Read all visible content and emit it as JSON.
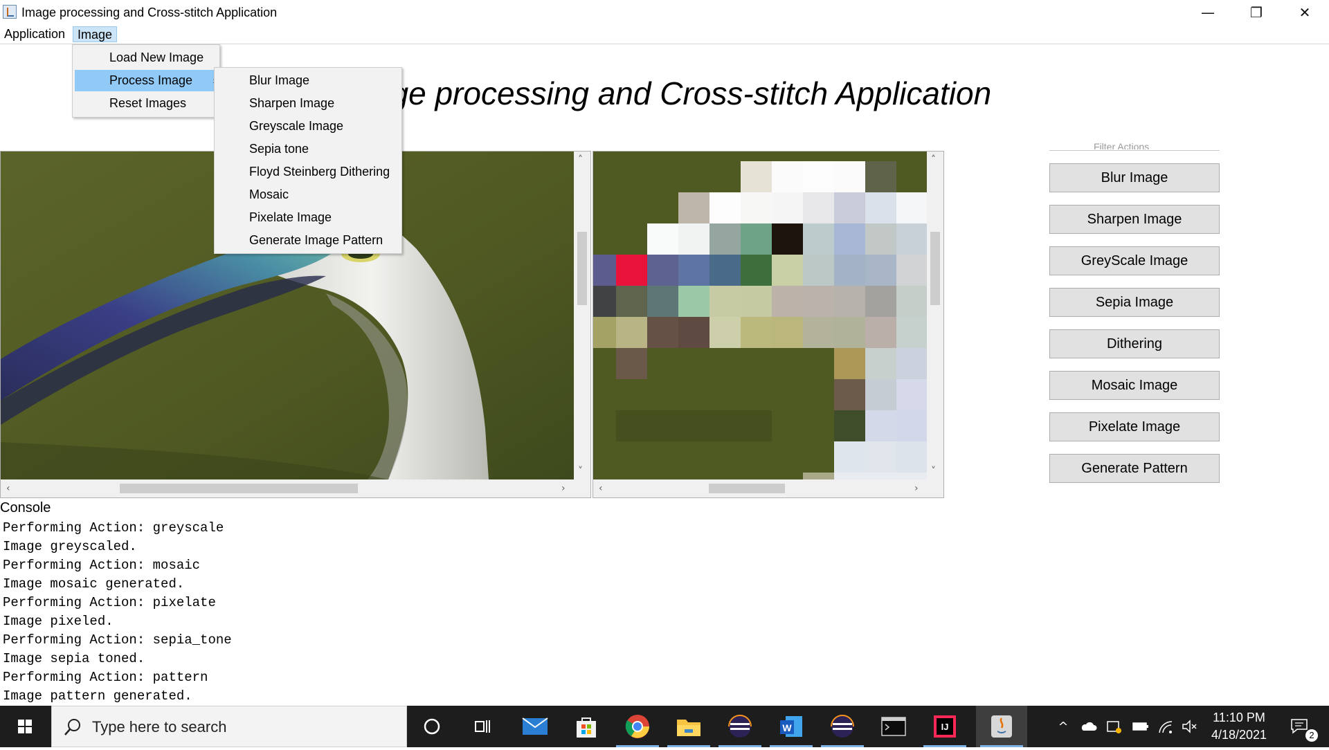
{
  "window": {
    "title": "Image processing and Cross-stitch Application",
    "minimize_glyph": "—",
    "restore_glyph": "❐",
    "close_glyph": "✕"
  },
  "menubar": {
    "items": [
      {
        "label": "Application"
      },
      {
        "label": "Image",
        "open": true
      }
    ]
  },
  "image_menu": {
    "items": [
      {
        "label": "Load New Image"
      },
      {
        "label": "Process Image",
        "has_submenu": true,
        "highlighted": true
      },
      {
        "label": "Reset Images"
      }
    ],
    "submenu_arrow": "›"
  },
  "process_submenu": {
    "items": [
      {
        "label": "Blur Image"
      },
      {
        "label": "Sharpen Image"
      },
      {
        "label": "Greyscale Image"
      },
      {
        "label": "Sepia tone"
      },
      {
        "label": "Floyd Steinberg Dithering"
      },
      {
        "label": "Mosaic"
      },
      {
        "label": "Pixelate Image"
      },
      {
        "label": "Generate Image Pattern"
      }
    ]
  },
  "heading": {
    "text": "Image processing and Cross-stitch Application"
  },
  "scroll_arrows": {
    "up": "˄",
    "down": "˅",
    "left": "‹",
    "right": "›"
  },
  "left_panel": {
    "image": "heron-photo",
    "vertical_scroll_fraction": 0.29,
    "horizontal_scroll_fraction": 0.34
  },
  "right_panel": {
    "image": "pixelated-heron",
    "vertical_scroll_fraction": 0.29,
    "horizontal_scroll_fraction": 0.44
  },
  "actions": {
    "group_label": "Filter Actions",
    "buttons": [
      {
        "label": "Blur Image"
      },
      {
        "label": "Sharpen Image"
      },
      {
        "label": "GreyScale Image"
      },
      {
        "label": "Sepia Image"
      },
      {
        "label": "Dithering"
      },
      {
        "label": "Mosaic Image"
      },
      {
        "label": "Pixelate Image"
      },
      {
        "label": "Generate Pattern"
      }
    ]
  },
  "console": {
    "label": "Console",
    "lines": [
      "Performing Action: greyscale",
      "Image greyscaled.",
      "Performing Action: mosaic",
      "Image mosaic generated.",
      "Performing Action: pixelate",
      "Image pixeled.",
      "Performing Action: sepia_tone",
      "Image sepia toned.",
      "Performing Action: pattern",
      "Image pattern generated."
    ]
  },
  "taskbar": {
    "search_placeholder": "Type here to search",
    "apps": [
      {
        "name": "cortana-icon",
        "active": false
      },
      {
        "name": "task-view-icon",
        "active": false
      },
      {
        "name": "mail-icon",
        "active": false
      },
      {
        "name": "store-icon",
        "active": false
      },
      {
        "name": "chrome-icon",
        "active": true
      },
      {
        "name": "file-explorer-icon",
        "active": true
      },
      {
        "name": "eclipse-icon",
        "active": true
      },
      {
        "name": "word-icon",
        "active": true
      },
      {
        "name": "eclipse-icon",
        "active": true
      },
      {
        "name": "terminal-icon",
        "active": false
      },
      {
        "name": "intellij-icon",
        "active": true
      },
      {
        "name": "java-icon",
        "active": true,
        "current": true
      }
    ],
    "tray": {
      "time": "11:10 PM",
      "date": "4/18/2021",
      "notification_count": "2"
    }
  },
  "colors": {
    "menu_highlight": "#91c9f7",
    "menu_open": "#cce4f7",
    "taskbar": "#1d1d1d",
    "photo_background": "#4e5a22"
  }
}
